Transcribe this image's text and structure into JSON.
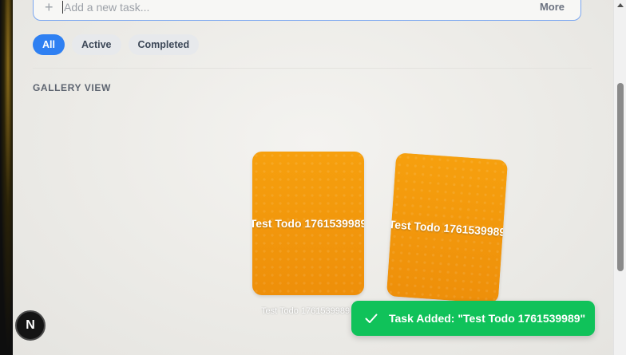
{
  "task_input": {
    "placeholder": "Add a new task...",
    "value": "",
    "more_label": "More",
    "plus_icon": "plus-icon"
  },
  "filters": [
    {
      "label": "All",
      "active": true
    },
    {
      "label": "Active",
      "active": false
    },
    {
      "label": "Completed",
      "active": false
    }
  ],
  "gallery": {
    "title": "GALLERY VIEW",
    "cards": [
      {
        "text": "Test Todo 1761539989"
      },
      {
        "text": "Test Todo 1761539989"
      }
    ],
    "caption": "Test Todo 1761539989"
  },
  "toast": {
    "message": "Task Added: \"Test Todo 1761539989\"",
    "icon": "check-icon",
    "color": "#10c25a"
  },
  "badge": {
    "letter": "N"
  },
  "colors": {
    "accent": "#2f80f2",
    "card": "#f2980a"
  }
}
